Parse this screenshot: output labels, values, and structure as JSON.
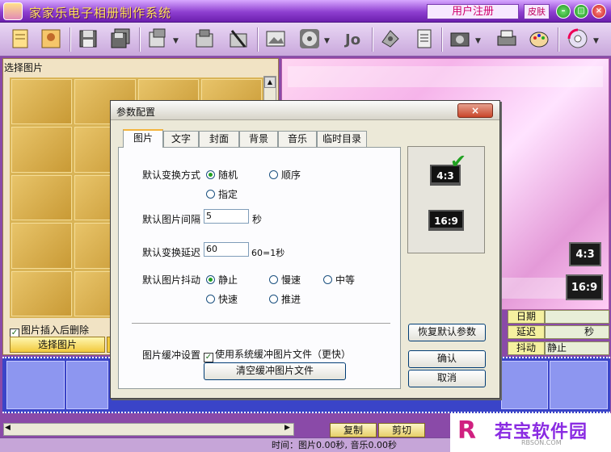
{
  "window": {
    "title": "家家乐电子相册制作系统",
    "register_label": "用户注册",
    "skin_label": "皮肤",
    "minimize": "–",
    "maximize": "□",
    "close": "×"
  },
  "toolbar": {
    "icons": [
      "new-album-icon",
      "open-image-icon",
      "save-icon",
      "save-all-icon",
      "import-icon",
      "export-icon",
      "delete-icon",
      "edit-image-icon",
      "disc-icon",
      "music-icon",
      "settings-icon",
      "document-icon",
      "camera-icon",
      "print-icon",
      "palette-icon",
      "burn-disc-icon"
    ]
  },
  "left_panel": {
    "title": "选择图片",
    "delete_after_insert": "图片插入后删除",
    "delete_after_insert_checked": true,
    "select_button": "选择图片"
  },
  "preview": {
    "ratio_43": "4:3",
    "ratio_169": "16:9"
  },
  "properties": {
    "rows": [
      {
        "label": "日期",
        "value": ""
      },
      {
        "label": "延迟",
        "value": "秒"
      },
      {
        "label": "抖动",
        "value": "静止"
      }
    ]
  },
  "bottom": {
    "copy_label": "复制",
    "cut_label": "剪切",
    "status": "时间：图片0.00秒, 音乐0.00秒"
  },
  "logo": {
    "mark": "R",
    "text": "若宝软件园",
    "sub": "RBSON.COM"
  },
  "dialog": {
    "title": "参数配置",
    "close_label": "×",
    "tabs": [
      "图片",
      "文字",
      "封面",
      "背景",
      "音乐",
      "临时目录"
    ],
    "active_tab": 0,
    "transition_mode": {
      "label": "默认变换方式",
      "options": [
        "随机",
        "顺序",
        "指定"
      ],
      "selected": "随机"
    },
    "interval": {
      "label": "默认图片间隔",
      "value": "5",
      "unit": "秒"
    },
    "delay": {
      "label": "默认变换延迟",
      "value": "60",
      "unit": "60=1秒"
    },
    "shake": {
      "label": "默认图片抖动",
      "options": [
        "静止",
        "慢速",
        "中等",
        "快速",
        "推进"
      ],
      "selected": "静止"
    },
    "cache": {
      "label": "图片缓冲设置",
      "checkbox_label": "使用系统缓冲图片文件（更快）",
      "checked": true,
      "clear_button": "清空缓冲图片文件"
    },
    "ratio_43": "4:3",
    "ratio_169": "16:9",
    "restore_button": "恢复默认参数",
    "ok_button": "确认",
    "cancel_button": "取消"
  },
  "colors": {
    "titlebar": "#8e3fd0",
    "title_text": "#ffe45a",
    "timeline": "#3a44c8",
    "check_green": "#21a121"
  }
}
